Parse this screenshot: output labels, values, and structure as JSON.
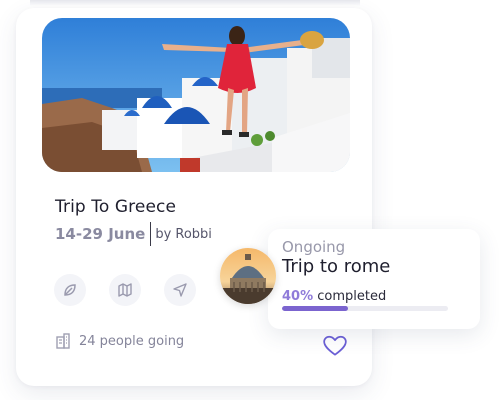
{
  "trip_card": {
    "title": "Trip To Greece",
    "dates": "14-29 June",
    "host": "by Robbi",
    "people_going": "24 people going",
    "actions": [
      {
        "icon": "leaf-icon"
      },
      {
        "icon": "map-icon"
      },
      {
        "icon": "navigation-arrow-icon"
      }
    ],
    "people_icon": "building-icon",
    "favorite_icon": "heart-icon"
  },
  "ongoing_trip": {
    "status": "Ongoing",
    "title": "Trip to rome",
    "progress_percent_label": "40%",
    "progress_label": "completed",
    "progress": 0.4
  },
  "colors": {
    "accent": "#7b64cf",
    "accent_text": "#8f7bd9",
    "heart": "#6b5fd6",
    "icon_grey": "#9a9aae"
  }
}
